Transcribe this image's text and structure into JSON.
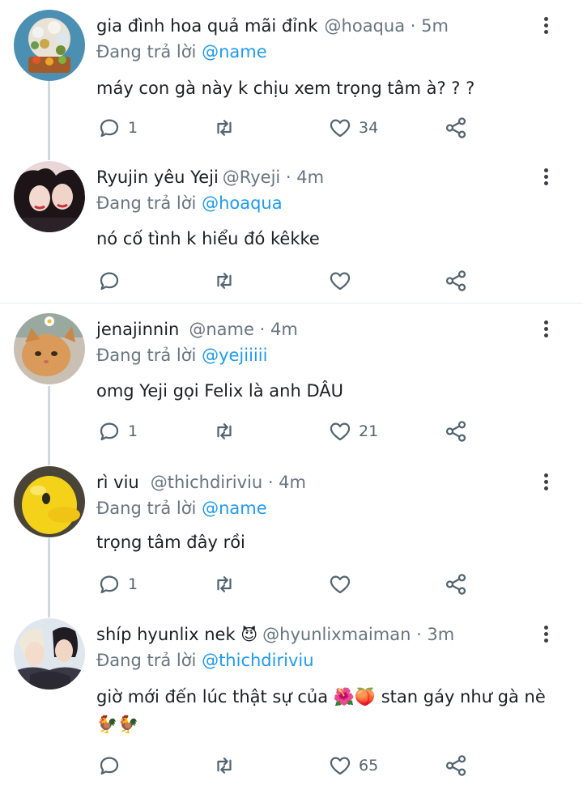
{
  "tweets": [
    {
      "name": "gia đình hoa quả mãi đỉnk",
      "handle": "@hoaqua · 5m",
      "reply_prefix": "Đang trả lời",
      "reply_to": "@name",
      "text": "máy con gà này k chịu xem trọng tâm à? ? ?",
      "replies": "1",
      "retweets": "",
      "likes": "34",
      "avatar": "flower-bouquet"
    },
    {
      "name": "Ryujin yêu Yeji",
      "handle": "@Ryeji · 4m",
      "reply_prefix": "Đang trả lời",
      "reply_to": "@hoaqua",
      "text": "nó cố tình k hiểu đó kêkke",
      "replies": "",
      "retweets": "",
      "likes": "",
      "avatar": "two-girls"
    },
    {
      "name": "jenajinnin",
      "handle": "@name · 4m",
      "reply_prefix": "Đang trả lời",
      "reply_to": "@yejiiiii",
      "text": "omg Yeji gọi Felix là anh DÂU",
      "replies": "1",
      "retweets": "",
      "likes": "21",
      "avatar": "kitten"
    },
    {
      "name": "rì viu",
      "handle": "@thichdiriviu · 4m",
      "reply_prefix": "Đang trả lời",
      "reply_to": "@name",
      "text": "trọng tâm đây rồi",
      "replies": "1",
      "retweets": "",
      "likes": "",
      "avatar": "yellow-duck"
    },
    {
      "name": "shíp hyunlix nek",
      "name_emoji": "😈",
      "handle": "@hyunlixmaiman · 3m",
      "reply_prefix": "Đang trả lời",
      "reply_to": "@thichdiriviu",
      "text": "giờ mới đến lúc thật sự của 🌺🍑 stan gáy như gà nè 🐓🐓",
      "replies": "",
      "retweets": "",
      "likes": "65",
      "avatar": "two-boys"
    }
  ],
  "colors": {
    "mention": "#1d9bf0",
    "muted": "#677580",
    "thread": "#cfd9de"
  }
}
